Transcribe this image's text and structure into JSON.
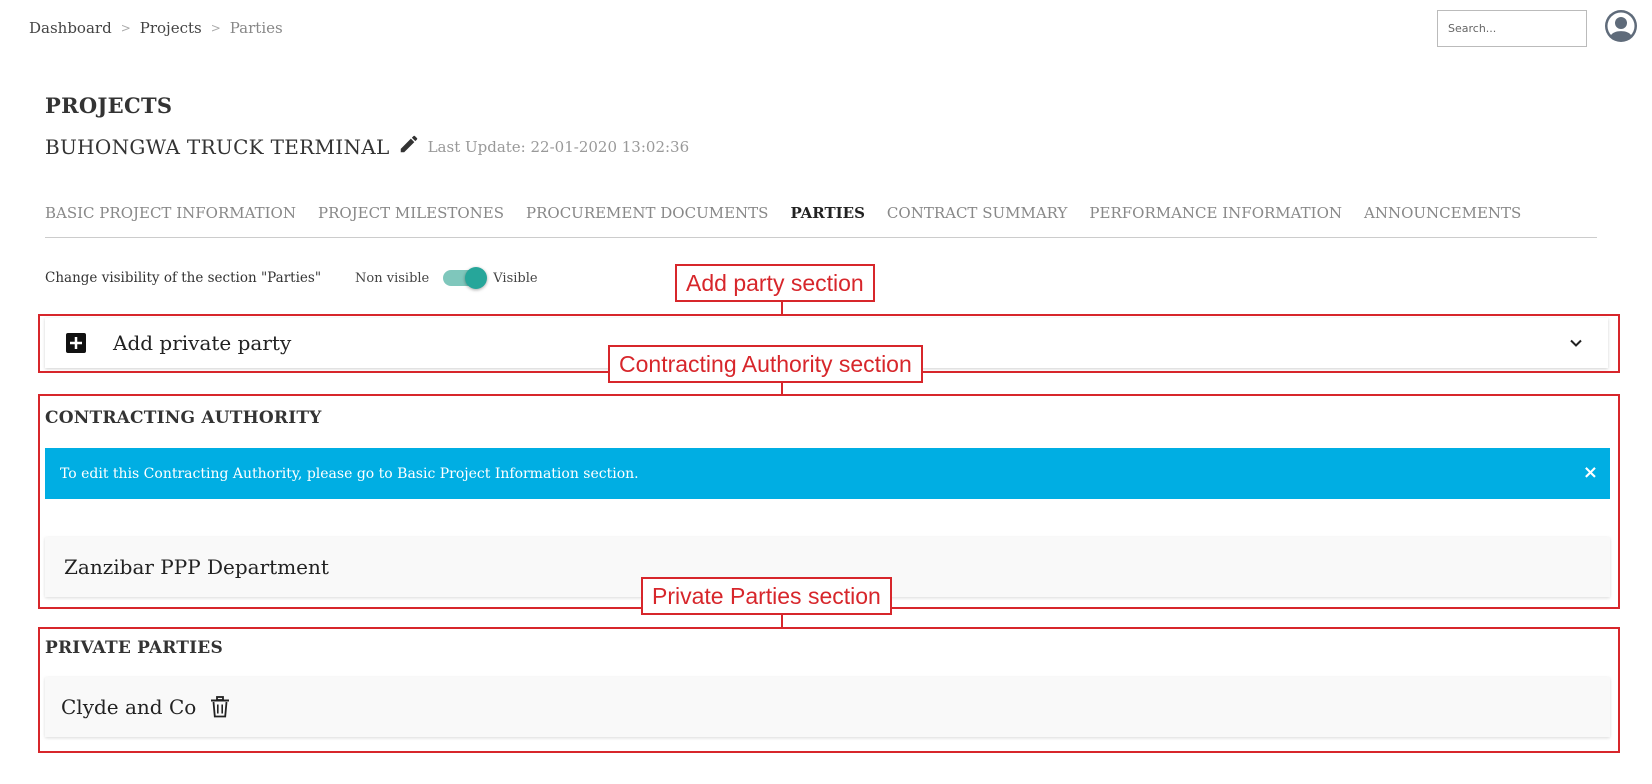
{
  "breadcrumb": [
    {
      "label": "Dashboard"
    },
    {
      "label": "Projects"
    },
    {
      "label": "Parties"
    }
  ],
  "breadcrumb_separator": ">",
  "search": {
    "placeholder": "Search..."
  },
  "page_heading": "PROJECTS",
  "project": {
    "title": "BUHONGWA TRUCK TERMINAL",
    "last_update": "Last Update: 22-01-2020 13:02:36"
  },
  "tabs": [
    {
      "label": "BASIC PROJECT INFORMATION",
      "active": false
    },
    {
      "label": "PROJECT MILESTONES",
      "active": false
    },
    {
      "label": "PROCUREMENT DOCUMENTS",
      "active": false
    },
    {
      "label": "PARTIES",
      "active": true
    },
    {
      "label": "CONTRACT SUMMARY",
      "active": false
    },
    {
      "label": "PERFORMANCE INFORMATION",
      "active": false
    },
    {
      "label": "ANNOUNCEMENTS",
      "active": false
    }
  ],
  "visibility": {
    "label": "Change visibility of the section \"Parties\"",
    "off_label": "Non visible",
    "on_label": "Visible",
    "state": "Visible"
  },
  "add_party": {
    "label": "Add private party"
  },
  "contracting_authority": {
    "title": "CONTRACTING AUTHORITY",
    "alert": "To edit this Contracting Authority, please go to Basic Project Information section.",
    "alert_close": "×",
    "name": "Zanzibar PPP Department"
  },
  "private_parties": {
    "title": "PRIVATE PARTIES",
    "items": [
      {
        "name": "Clyde and Co"
      }
    ]
  },
  "annotations": {
    "add_party": "Add party section",
    "contracting_authority": "Contracting Authority section",
    "private_parties": "Private Parties section"
  },
  "colors": {
    "annotation": "#d7262b",
    "alert_bg": "#00aee3",
    "toggle_on": "#26a69a",
    "toggle_track": "#7fc7bc"
  },
  "icons": [
    "edit-icon",
    "add-box-icon",
    "chevron-down-icon",
    "close-icon",
    "trash-icon",
    "avatar-icon"
  ]
}
